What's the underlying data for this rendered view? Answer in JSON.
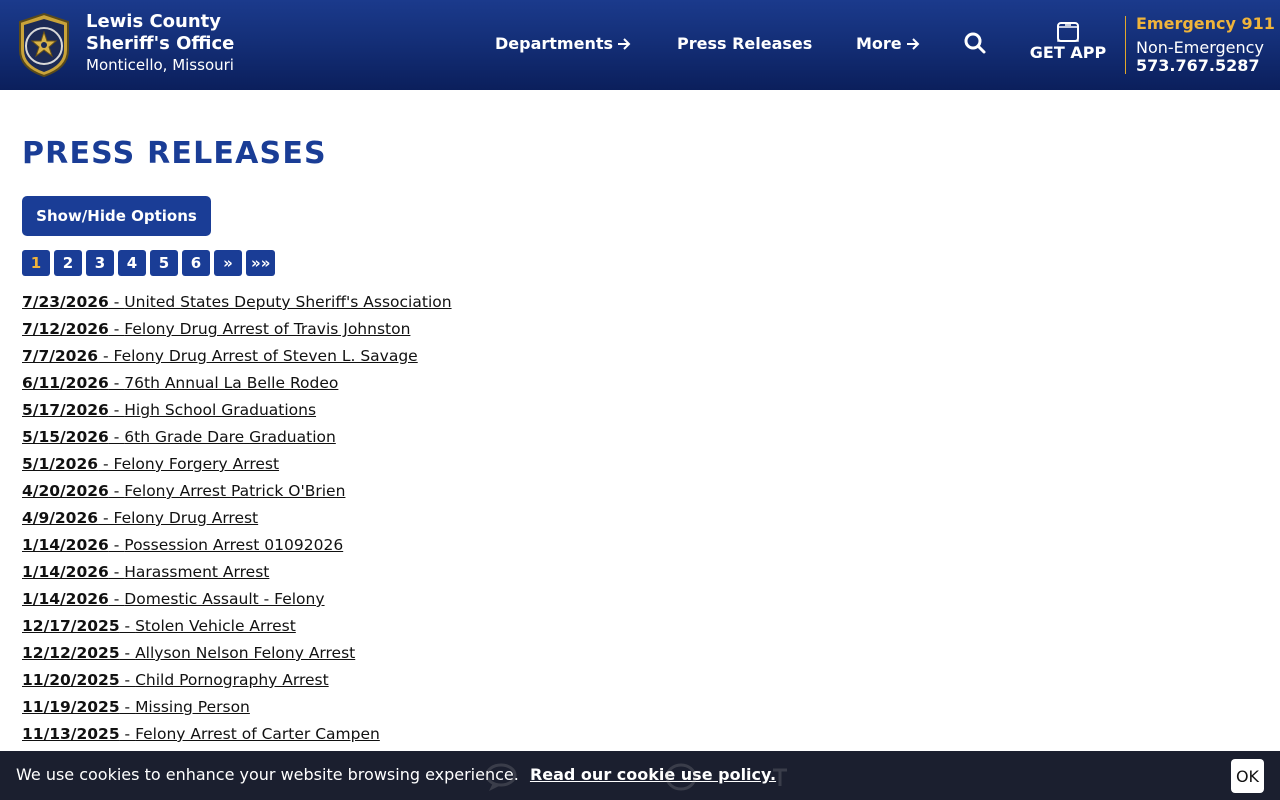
{
  "header": {
    "brand_line1": "Lewis County",
    "brand_line2": "Sheriff's Office",
    "brand_line3": "Monticello, Missouri",
    "logo_icon": "sheriff-badge-icon",
    "nav": {
      "departments": "Departments",
      "press_releases": "Press Releases",
      "more": "More"
    },
    "search_icon": "search-icon",
    "get_app_label": "GET APP",
    "emergency": "Emergency 911",
    "non_emergency_label": "Non-Emergency",
    "non_emergency_phone": "573.767.5287",
    "colors": {
      "navy": "#142f78",
      "gold": "#f0b43a"
    }
  },
  "main": {
    "title": "PRESS RELEASES",
    "options_button": "Show/Hide Options",
    "pagination": [
      "1",
      "2",
      "3",
      "4",
      "5",
      "6",
      "»",
      "»»"
    ],
    "current_page": "1",
    "releases": [
      {
        "date": "7/23/2026",
        "title": "United States Deputy Sheriff's Association"
      },
      {
        "date": "7/12/2026",
        "title": "Felony Drug Arrest of Travis Johnston"
      },
      {
        "date": "7/7/2026",
        "title": "Felony Drug Arrest of Steven L. Savage"
      },
      {
        "date": "6/11/2026",
        "title": "76th Annual La Belle Rodeo"
      },
      {
        "date": "5/17/2026",
        "title": "High School Graduations"
      },
      {
        "date": "5/15/2026",
        "title": "6th Grade Dare Graduation"
      },
      {
        "date": "5/1/2026",
        "title": "Felony Forgery Arrest"
      },
      {
        "date": "4/20/2026",
        "title": "Felony Arrest Patrick O'Brien"
      },
      {
        "date": "4/9/2026",
        "title": "Felony Drug Arrest"
      },
      {
        "date": "1/14/2026",
        "title": "Possession Arrest 01092026"
      },
      {
        "date": "1/14/2026",
        "title": "Harassment Arrest"
      },
      {
        "date": "1/14/2026",
        "title": "Domestic Assault - Felony"
      },
      {
        "date": "12/17/2025",
        "title": "Stolen Vehicle Arrest"
      },
      {
        "date": "12/12/2025",
        "title": "Allyson Nelson Felony Arrest"
      },
      {
        "date": "11/20/2025",
        "title": "Child Pornography Arrest"
      },
      {
        "date": "11/19/2025",
        "title": "Missing Person"
      },
      {
        "date": "11/13/2025",
        "title": "Felony Arrest of Carter Campen"
      }
    ]
  },
  "cookie": {
    "text": "We use cookies to enhance your website browsing experience.",
    "link": "Read our cookie use policy.",
    "ok": "OK"
  }
}
